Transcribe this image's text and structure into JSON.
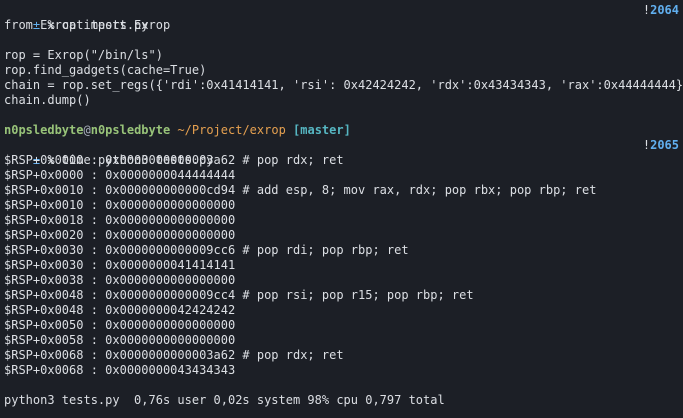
{
  "prompt_fragment_top": {
    "color_user": "#98c379",
    "color_path": "#e5a050",
    "color_branch": "#56b6c2"
  },
  "prompt1": {
    "pm": "±",
    "cmd": " % cat tests.py",
    "bang": "!",
    "histnum": "2064"
  },
  "file_lines": [
    "from Exrop import Exrop",
    "",
    "rop = Exrop(\"/bin/ls\")",
    "rop.find_gadgets(cache=True)",
    "chain = rop.set_regs({'rdi':0x41414141, 'rsi': 0x42424242, 'rdx':0x43434343, 'rax':0x44444444})",
    "chain.dump()",
    ""
  ],
  "prompt2_header": {
    "user": "n0psledbyte",
    "at": "@",
    "host": "n0psledbyte",
    "path": " ~/Project/exrop",
    "branch": " [master]"
  },
  "prompt2": {
    "pm": "±",
    "cmd": " % time python3 tests.py",
    "bang": "!",
    "histnum": "2065"
  },
  "output_lines": [
    "$RSP+0x0000 : 0x0000000000003a62 # pop rdx; ret",
    "$RSP+0x0000 : 0x0000000044444444",
    "$RSP+0x0010 : 0x000000000000cd94 # add esp, 8; mov rax, rdx; pop rbx; pop rbp; ret",
    "$RSP+0x0010 : 0x0000000000000000",
    "$RSP+0x0018 : 0x0000000000000000",
    "$RSP+0x0020 : 0x0000000000000000",
    "$RSP+0x0030 : 0x0000000000009cc6 # pop rdi; pop rbp; ret",
    "$RSP+0x0030 : 0x0000000041414141",
    "$RSP+0x0038 : 0x0000000000000000",
    "$RSP+0x0048 : 0x0000000000009cc4 # pop rsi; pop r15; pop rbp; ret",
    "$RSP+0x0048 : 0x0000000042424242",
    "$RSP+0x0050 : 0x0000000000000000",
    "$RSP+0x0058 : 0x0000000000000000",
    "$RSP+0x0068 : 0x0000000000003a62 # pop rdx; ret",
    "$RSP+0x0068 : 0x0000000043434343",
    ""
  ],
  "time_line": "python3 tests.py  0,76s user 0,02s system 98% cpu 0,797 total"
}
